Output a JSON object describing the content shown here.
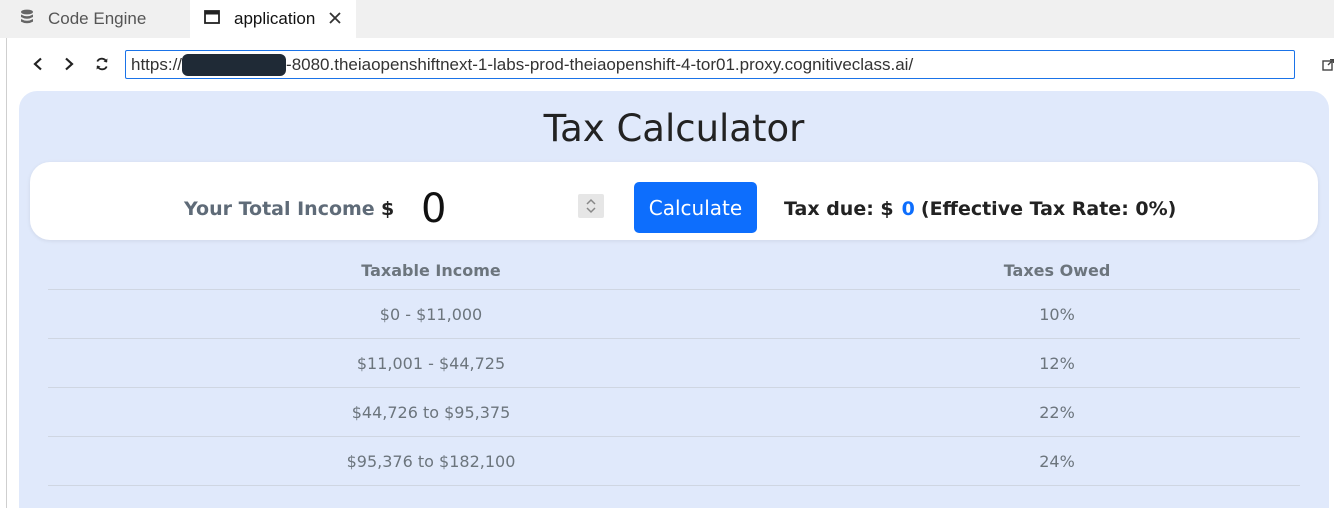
{
  "tabs": [
    {
      "label": "Code Engine",
      "icon": "database-icon"
    },
    {
      "label": "application",
      "icon": "window-icon"
    }
  ],
  "address_bar": {
    "url_prefix": "https://",
    "url_suffix": "-8080.theiaopenshiftnext-1-labs-prod-theiaopenshift-4-tor01.proxy.cognitiveclass.ai/"
  },
  "app": {
    "title": "Tax Calculator",
    "income_label": "Your Total Income",
    "currency_symbol": "$",
    "income_value": "0",
    "calculate_label": "Calculate",
    "tax_due_label": "Tax due: $",
    "tax_due_value": "0",
    "effective_rate_text": "(Effective Tax Rate:  0%)"
  },
  "table": {
    "headers": [
      "Taxable Income",
      "Taxes Owed"
    ],
    "rows": [
      [
        "$0 - $11,000",
        "10%"
      ],
      [
        "$11,001 - $44,725",
        "12%"
      ],
      [
        "$44,726 to $95,375",
        "22%"
      ],
      [
        "$95,376 to $182,100",
        "24%"
      ]
    ]
  },
  "colors": {
    "accent": "#0d6efd",
    "app_background": "#e0e9fb",
    "label_gray": "#5f6b78"
  }
}
